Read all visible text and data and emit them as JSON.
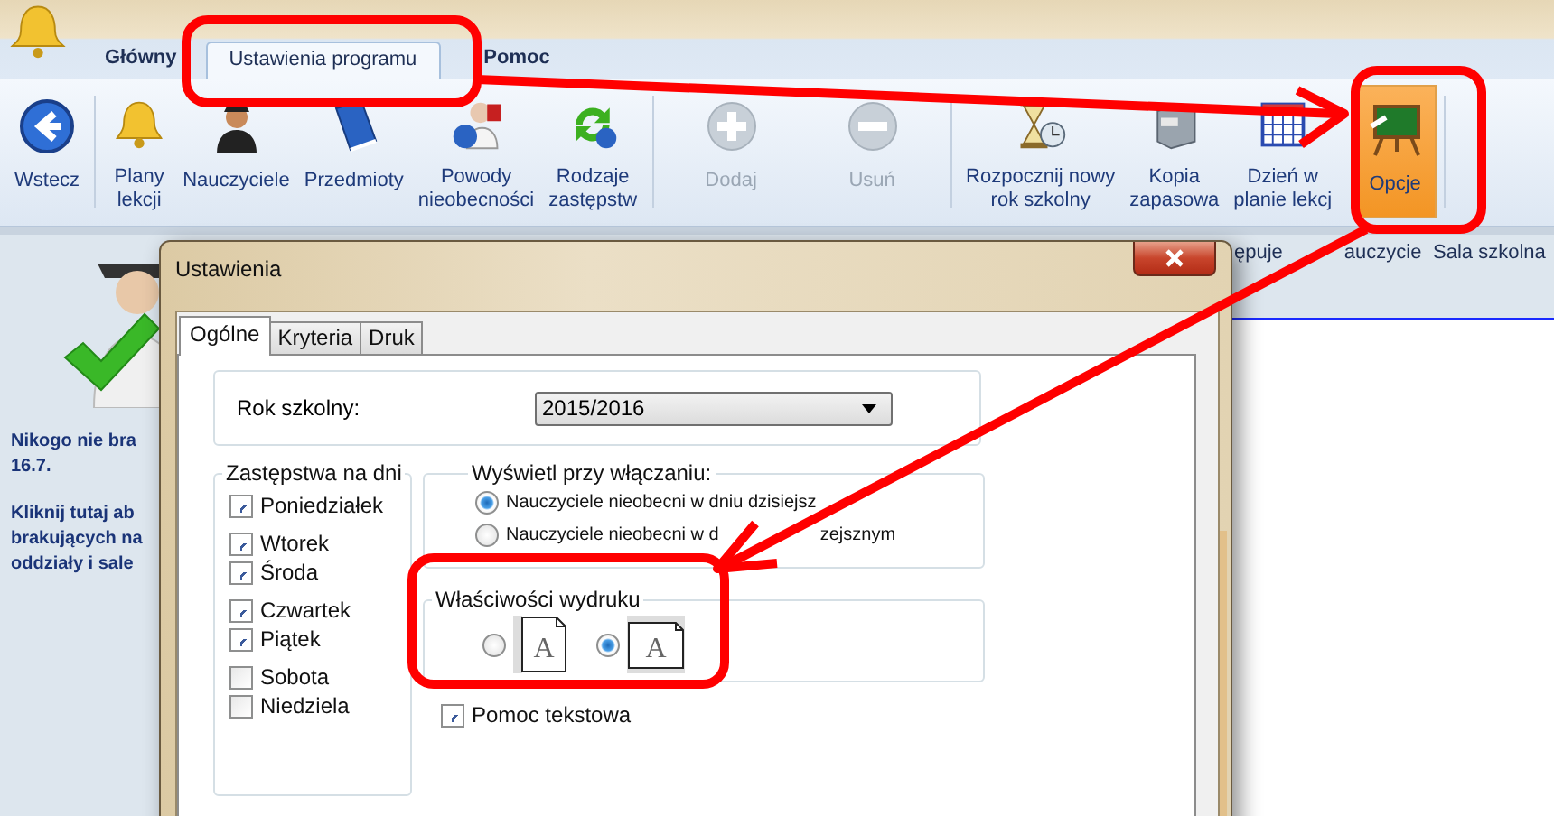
{
  "app": {
    "tabs": [
      {
        "label": "Główny",
        "selected": false
      },
      {
        "label": "Ustawienia programu",
        "selected": true
      },
      {
        "label": "Pomoc",
        "selected": false
      }
    ]
  },
  "ribbon": {
    "groups": [
      {
        "buttons": [
          {
            "kind": "back",
            "label": "Wstecz",
            "disabled": false,
            "selected": false
          }
        ]
      },
      {
        "buttons": [
          {
            "kind": "bell",
            "label": "Plany\nlekcji",
            "disabled": false,
            "selected": false
          },
          {
            "kind": "person",
            "label": "Nauczyciele",
            "disabled": false,
            "selected": false
          },
          {
            "kind": "book",
            "label": "Przedmioty",
            "disabled": false,
            "selected": false
          },
          {
            "kind": "help-person",
            "label": "Powody\nnieobecności",
            "disabled": false,
            "selected": false
          },
          {
            "kind": "cycle",
            "label": "Rodzaje\nzastępstw",
            "disabled": false,
            "selected": false
          }
        ]
      },
      {
        "buttons": [
          {
            "kind": "plus",
            "label": "Dodaj",
            "disabled": true,
            "selected": false
          },
          {
            "kind": "minus",
            "label": "Usuń",
            "disabled": true,
            "selected": false
          }
        ]
      },
      {
        "buttons": [
          {
            "kind": "hourglass",
            "label": "Rozpocznij nowy\nrok szkolny",
            "disabled": false,
            "selected": false
          },
          {
            "kind": "drawer",
            "label": "Kopia\nzapasowa",
            "disabled": false,
            "selected": false
          },
          {
            "kind": "calendar",
            "label": "Dzień w\nplanie lekcj",
            "disabled": false,
            "selected": false
          },
          {
            "kind": "board",
            "label": "Opcje",
            "disabled": false,
            "selected": true
          }
        ]
      }
    ]
  },
  "side_panel": {
    "paragraphs": [
      [
        "Nikogo nie bra",
        "16.7."
      ],
      [
        "Kliknij tutaj ab",
        "brakujących na",
        "oddziały i sale"
      ]
    ]
  },
  "table": {
    "columns": [
      {
        "visible_parts": [
          "ępuje",
          "auczycie"
        ]
      },
      {
        "visible_parts": [
          "Sala szkolna"
        ]
      }
    ]
  },
  "dialog": {
    "title": "Ustawienia",
    "tabs": [
      {
        "label": "Ogólne",
        "selected": true
      },
      {
        "label": "Kryteria",
        "selected": false
      },
      {
        "label": "Druk",
        "selected": false
      }
    ],
    "school_year": {
      "label": "Rok szkolny:",
      "value": "2015/2016"
    },
    "days": {
      "title": "Zastępstwa na dni",
      "items": [
        {
          "label": "Poniedziałek",
          "checked": true
        },
        {
          "label": "Wtorek",
          "checked": true
        },
        {
          "label": "Środa",
          "checked": true
        },
        {
          "label": "Czwartek",
          "checked": true
        },
        {
          "label": "Piątek",
          "checked": true
        },
        {
          "label": "Sobota",
          "checked": false
        },
        {
          "label": "Niedziela",
          "checked": false
        }
      ]
    },
    "startup": {
      "title": "Wyświetl przy włączaniu:",
      "options": [
        {
          "visible_parts": [
            "Nauczyciele nieobecni w dniu dzisiejsz"
          ],
          "selected": true
        },
        {
          "visible_parts": [
            "Nauczyciele nieobecni w d",
            "zejsznym"
          ],
          "selected": false
        }
      ]
    },
    "print": {
      "title": "Właściwości wydruku",
      "options": [
        {
          "kind": "portrait",
          "icon_letter": "A",
          "selected": false
        },
        {
          "kind": "landscape",
          "icon_letter": "A",
          "selected": true
        }
      ]
    },
    "help_text": {
      "label": "Pomoc tekstowa",
      "checked": true
    }
  }
}
